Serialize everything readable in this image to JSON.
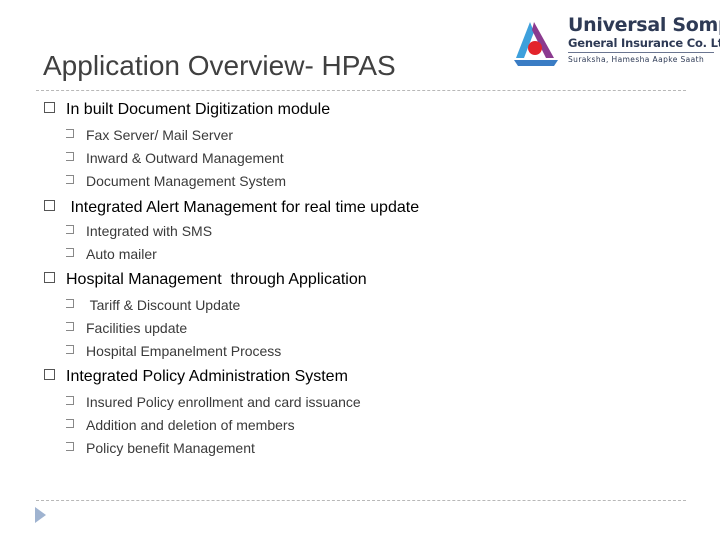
{
  "slide": {
    "title": "Application Overview- HPAS"
  },
  "logo": {
    "line1": "Universal Sompo",
    "line2": "General Insurance Co. Ltd.",
    "tagline": "Suraksha, Hamesha Aapke Saath",
    "colors": {
      "blue": "#3ea0dc",
      "purple": "#8b3a8f",
      "red": "#e3242b",
      "navy": "#2e3a55"
    }
  },
  "bullets": [
    {
      "text": "In built Document Digitization module",
      "children": [
        "Fax Server/ Mail Server",
        "Inward  & Outward Management",
        "Document Management System"
      ]
    },
    {
      "text": " Integrated Alert Management for real time update",
      "children": [
        "Integrated with SMS",
        "Auto mailer"
      ]
    },
    {
      "text": "Hospital Management  through Application",
      "children": [
        " Tariff & Discount Update",
        "Facilities update",
        "Hospital Empanelment Process"
      ]
    },
    {
      "text": "Integrated Policy Administration System",
      "children": [
        "Insured Policy enrollment and card issuance",
        "Addition and deletion of members",
        "Policy benefit Management"
      ]
    }
  ],
  "nav": {
    "icon": "next-slide-arrow-icon"
  }
}
